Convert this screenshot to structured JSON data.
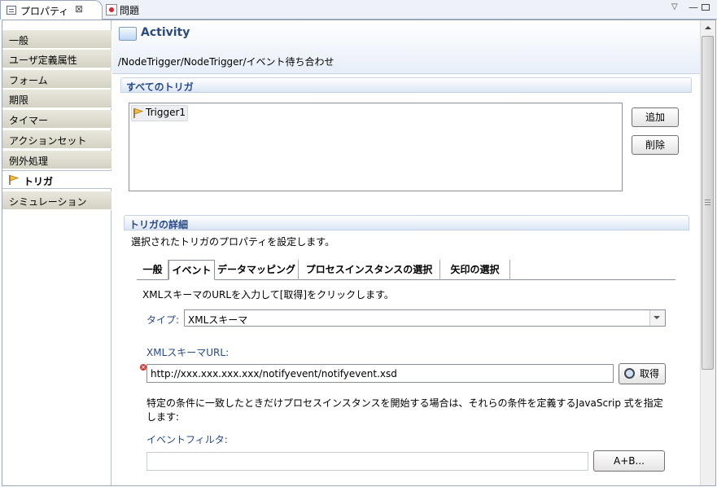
{
  "view_tabs": {
    "properties_label": "プロパティ",
    "properties_close": "⊠",
    "problems_label": "問題"
  },
  "view_controls": {
    "menu": "▽",
    "minimize": "—"
  },
  "sidebar": {
    "items": [
      {
        "label": "一般"
      },
      {
        "label": "ユーザ定義属性"
      },
      {
        "label": "フォーム"
      },
      {
        "label": "期限"
      },
      {
        "label": "タイマー"
      },
      {
        "label": "アクションセット"
      },
      {
        "label": "例外処理"
      },
      {
        "label": "トリガ",
        "selected": true,
        "icon": "flag-icon"
      },
      {
        "label": "シミュレーション"
      }
    ]
  },
  "header": {
    "title": "Activity",
    "breadcrumb": "/NodeTrigger/NodeTrigger/イベント待ち合わせ"
  },
  "all_triggers": {
    "heading": "すべてのトリガ",
    "items": [
      {
        "label": "Trigger1"
      }
    ],
    "add_label": "追加",
    "delete_label": "削除"
  },
  "trigger_detail": {
    "heading": "トリガの詳細",
    "description": "選択されたトリガのプロパティを設定します。",
    "tabs": [
      {
        "label": "一般"
      },
      {
        "label": "イベント",
        "selected": true
      },
      {
        "label": "データマッピング"
      },
      {
        "label": "プロセスインスタンスの選択"
      },
      {
        "label": "矢印の選択"
      }
    ]
  },
  "event_tab": {
    "description": "XMLスキーマのURLを入力して[取得]をクリックします。",
    "type_label": "タイプ:",
    "type_value": "XMLスキーマ",
    "url_label": "XMLスキーマURL:",
    "url_value": "http://xxx.xxx.xxx.xxx/notifyevent/notifyevent.xsd",
    "fetch_label": "取得",
    "filter_desc_1": "特定の条件に一致したときだけプロセスインスタンスを開始する場合は、それらの条件を定義するJavaScrip 式を指定",
    "filter_desc_2": "します:",
    "filter_label": "イベントフィルタ:",
    "filter_value": "",
    "expr_button_label": "A+B..."
  },
  "colors": {
    "accent": "#27498a",
    "sidebar_bg": "#d4d2c3",
    "error": "#d8342b"
  }
}
